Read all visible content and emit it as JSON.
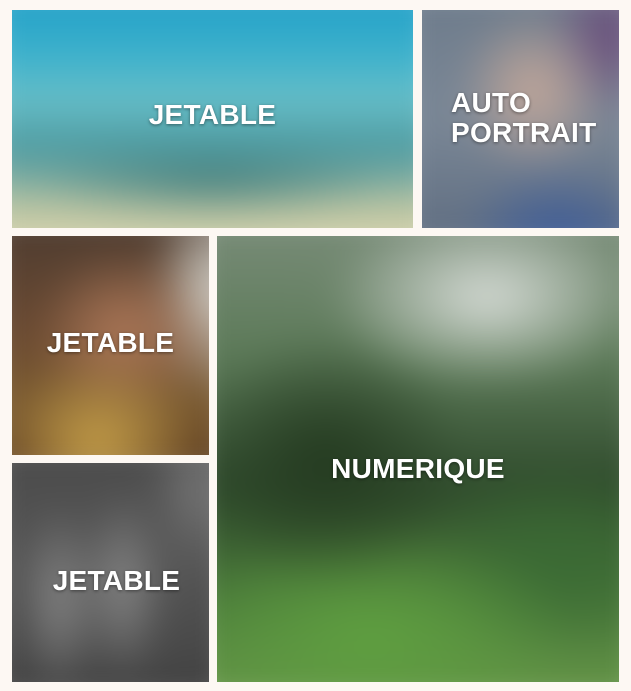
{
  "gallery": {
    "tiles": [
      {
        "label": "JETABLE"
      },
      {
        "label": "AUTO\nPORTRAIT"
      },
      {
        "label": "JETABLE"
      },
      {
        "label": "JETABLE"
      },
      {
        "label": "NUMERIQUE"
      }
    ]
  },
  "colors": {
    "page_background": "#fdf8f3",
    "label_text": "#ffffff"
  }
}
